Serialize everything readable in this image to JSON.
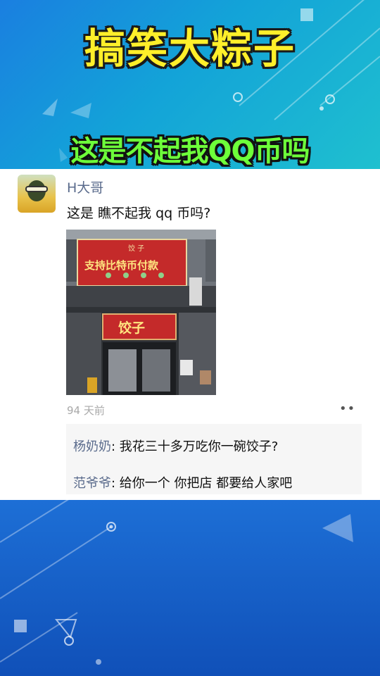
{
  "banner": {
    "title": "搞笑大粽子",
    "subtitle": "这是不起我QQ币吗"
  },
  "post": {
    "username": "H大哥",
    "text": "这是 瞧不起我 qq 币吗?",
    "timestamp": "94 天前",
    "more_icon": "more-dots-icon",
    "photo": {
      "sign_top_small": "饺 子",
      "sign_top_main": "支持比特币付款",
      "sign_bottom": "饺子"
    }
  },
  "comments": [
    {
      "author": "杨奶奶",
      "text": ": 我花三十多万吃你一碗饺子?"
    },
    {
      "author": "范爷爷",
      "text": ": 给你一个  你把店 都要给人家吧"
    }
  ],
  "colors": {
    "title_yellow": "#ffef2a",
    "subtitle_green": "#6dff3a",
    "name_blue": "#5a6b8c"
  }
}
